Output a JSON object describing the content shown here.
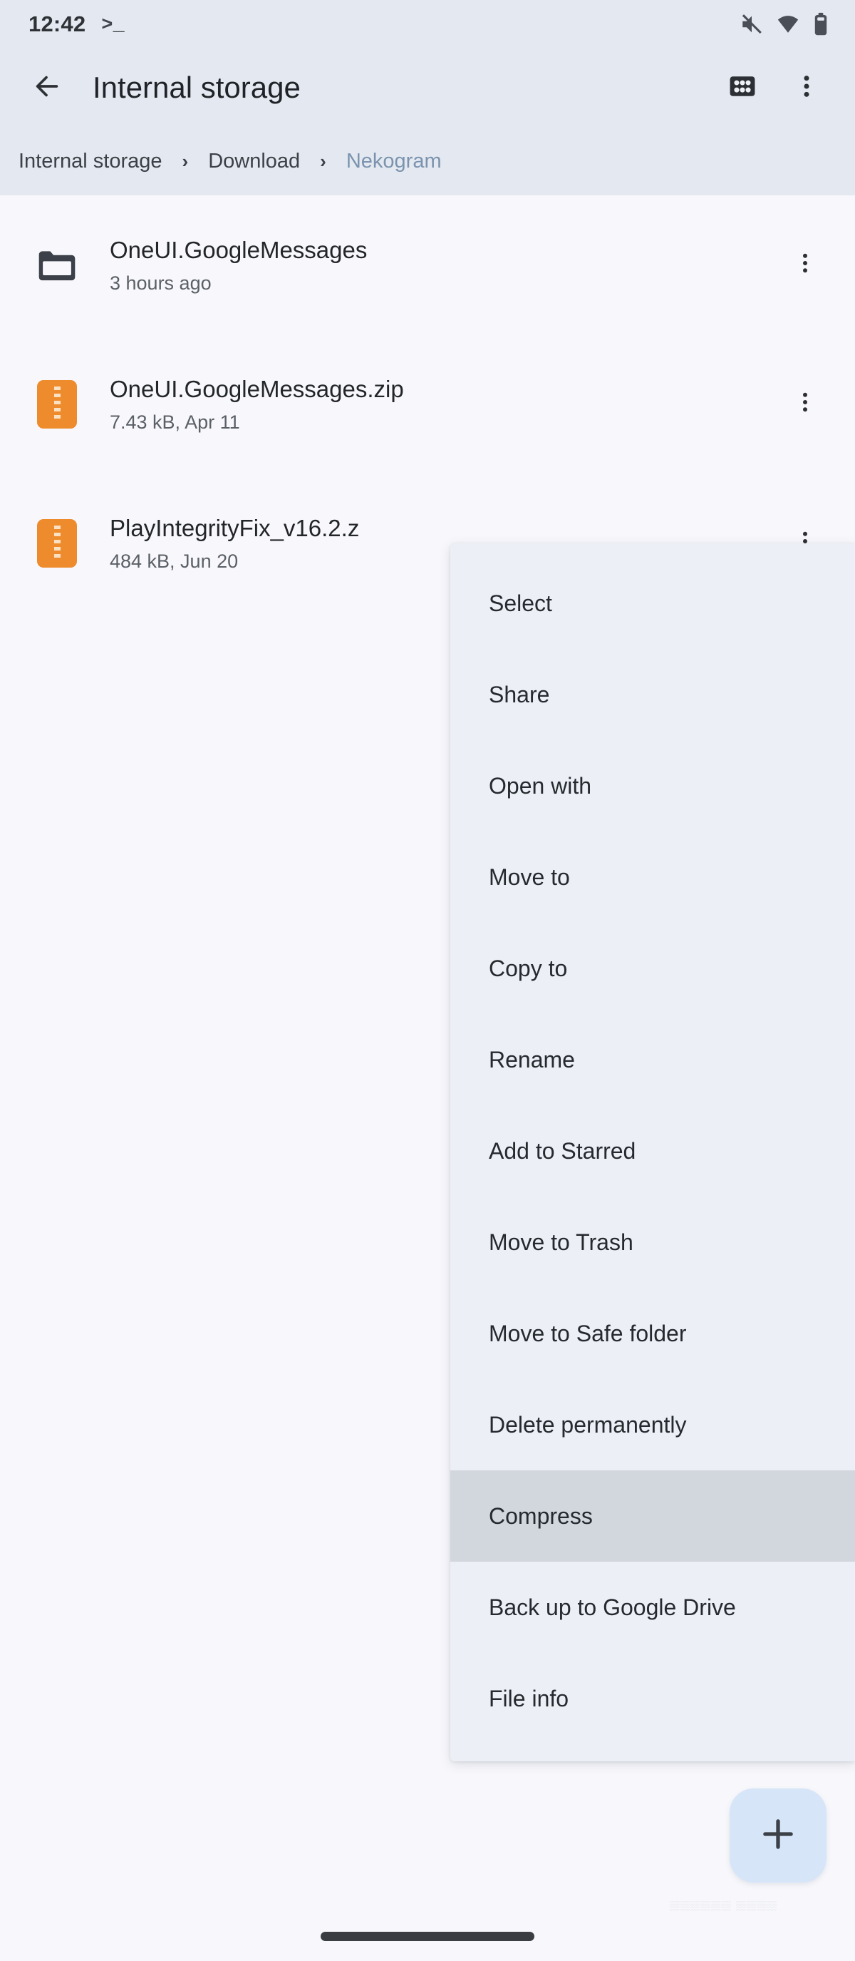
{
  "status_bar": {
    "clock": "12:42",
    "terminal_glyph": ">_",
    "icons": [
      "mute-icon",
      "wifi-icon",
      "battery-icon"
    ]
  },
  "app_bar": {
    "back_icon": "back-arrow-icon",
    "title": "Internal storage",
    "grid_icon": "grid-view-icon",
    "overflow_icon": "overflow-menu-icon"
  },
  "breadcrumb": {
    "separator": "›",
    "items": [
      {
        "label": "Internal storage",
        "current": false
      },
      {
        "label": "Download",
        "current": false
      },
      {
        "label": "Nekogram",
        "current": true
      }
    ]
  },
  "file_list": [
    {
      "icon": "folder-icon",
      "name": "OneUI.GoogleMessages",
      "meta": "3 hours ago",
      "more_icon": "overflow-menu-icon"
    },
    {
      "icon": "zip-file-icon",
      "name": "OneUI.GoogleMessages.zip",
      "meta": "7.43 kB, Apr 11",
      "more_icon": "overflow-menu-icon"
    },
    {
      "icon": "zip-file-icon",
      "name": "PlayIntegrityFix_v16.2.z",
      "meta": "484 kB, Jun 20",
      "more_icon": "overflow-menu-icon"
    }
  ],
  "context_menu": {
    "items": [
      {
        "label": "Select",
        "highlighted": false
      },
      {
        "label": "Share",
        "highlighted": false
      },
      {
        "label": "Open with",
        "highlighted": false
      },
      {
        "label": "Move to",
        "highlighted": false
      },
      {
        "label": "Copy to",
        "highlighted": false
      },
      {
        "label": "Rename",
        "highlighted": false
      },
      {
        "label": "Add to Starred",
        "highlighted": false
      },
      {
        "label": "Move to Trash",
        "highlighted": false
      },
      {
        "label": "Move to Safe folder",
        "highlighted": false
      },
      {
        "label": "Delete permanently",
        "highlighted": false
      },
      {
        "label": "Compress",
        "highlighted": true
      },
      {
        "label": "Back up to Google Drive",
        "highlighted": false
      },
      {
        "label": "File info",
        "highlighted": false
      }
    ]
  },
  "fab": {
    "icon": "plus-icon",
    "label": "+"
  },
  "watermark": {
    "text": "▒▒▒▒▒▒ ▒▒▒▒"
  },
  "colors": {
    "app_bar_bg": "#e4e9f1",
    "content_bg": "#f8f8fc",
    "menu_bg": "#eceff5",
    "menu_highlight": "#d2d6dd",
    "zip_orange": "#ED8B2D",
    "fab_blue": "#d6e5f8",
    "breadcrumb_current": "#7b93ae"
  }
}
